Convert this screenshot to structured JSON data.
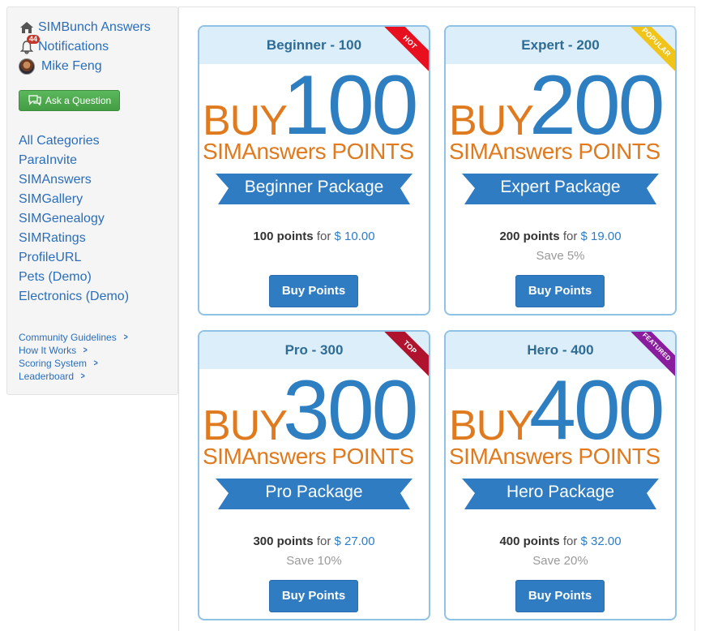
{
  "sidebar": {
    "home_label": "SIMBunch Answers",
    "notifications_label": "Notifications",
    "notifications_count": "44",
    "user_name": "Mike Feng",
    "ask_button": "Ask a Question",
    "categories": [
      "All Categories",
      "ParaInvite",
      "SIMAnswers",
      "SIMGallery",
      "SIMGenealogy",
      "SIMRatings",
      "ProfileURL",
      "Pets (Demo)",
      "Electronics (Demo)"
    ],
    "footer_links": [
      "Community Guidelines",
      "How It Works",
      "Scoring System",
      "Leaderboard"
    ]
  },
  "packages": [
    {
      "title": "Beginner - 100",
      "ribbon": "HOT",
      "ribbon_color": "#e8101e",
      "buy": "BUY",
      "number": "100",
      "points_word": "SIMAnswers POINTS",
      "banner": "Beginner Package",
      "points_text": "100 points",
      "for": "for",
      "price": "$ 10.00",
      "save": "",
      "button": "Buy Points"
    },
    {
      "title": "Expert - 200",
      "ribbon": "POPULAR",
      "ribbon_color": "#f0c419",
      "buy": "BUY",
      "number": "200",
      "points_word": "SIMAnswers POINTS",
      "banner": "Expert Package",
      "points_text": "200 points",
      "for": "for",
      "price": "$ 19.00",
      "save": "Save 5%",
      "button": "Buy Points"
    },
    {
      "title": "Pro - 300",
      "ribbon": "TOP",
      "ribbon_color": "#b0132e",
      "buy": "BUY",
      "number": "300",
      "points_word": "SIMAnswers POINTS",
      "banner": "Pro Package",
      "points_text": "300 points",
      "for": "for",
      "price": "$ 27.00",
      "save": "Save 10%",
      "button": "Buy Points"
    },
    {
      "title": "Hero - 400",
      "ribbon": "FEATURED",
      "ribbon_color": "#8a1c9e",
      "buy": "BUY",
      "number": "400",
      "points_word": "SIMAnswers POINTS",
      "banner": "Hero Package",
      "points_text": "400 points",
      "for": "for",
      "price": "$ 32.00",
      "save": "Save 20%",
      "button": "Buy Points"
    }
  ],
  "colors": {
    "link": "#2a6ebb",
    "accent_blue": "#2f7cc3",
    "orange": "#e07a1e",
    "green": "#5cb85c"
  },
  "icons": {
    "home": "home-icon",
    "notifications": "bell-icon",
    "ask": "speech-bubble-icon",
    "chevron": "chevron-right-icon"
  }
}
